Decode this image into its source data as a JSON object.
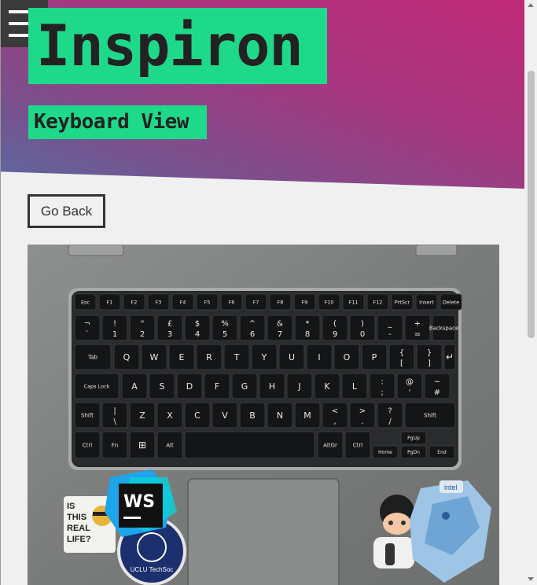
{
  "header": {
    "title": "Inspiron",
    "subtitle": "Keyboard View"
  },
  "menu": {
    "icon": "hamburger-menu-icon"
  },
  "actions": {
    "back_label": "Go Back"
  },
  "photo": {
    "subject": "laptop-keyboard-photo",
    "row_fn": [
      "Esc",
      "F1",
      "F2",
      "F3",
      "F4",
      "F5",
      "F6",
      "F7",
      "F8",
      "F9",
      "F10",
      "F11",
      "F12",
      "PrtScr",
      "Insert",
      "Delete"
    ],
    "row_num_top": [
      "¬",
      "!",
      "\"",
      "£",
      "$",
      "%",
      "^",
      "&",
      "*",
      "(",
      ")",
      "_",
      "+"
    ],
    "row_num_bottom": [
      "`",
      "1",
      "2",
      "3",
      "4",
      "5",
      "6",
      "7",
      "8",
      "9",
      "0",
      "-",
      "="
    ],
    "row_q": [
      "Q",
      "W",
      "E",
      "R",
      "T",
      "Y",
      "U",
      "I",
      "O",
      "P"
    ],
    "row_a": [
      "A",
      "S",
      "D",
      "F",
      "G",
      "H",
      "J",
      "K",
      "L"
    ],
    "row_z": [
      "Z",
      "X",
      "C",
      "V",
      "B",
      "N",
      "M"
    ],
    "mods": {
      "backspace": "Backspace",
      "tab": "Tab",
      "caps": "Caps Lock",
      "shift_l": "Shift",
      "shift_r": "Shift",
      "ctrl_l": "Ctrl",
      "fn": "Fn",
      "alt": "Alt",
      "altgr": "AltGr",
      "ctrl_r": "Ctrl",
      "home": "Home",
      "pgup": "PgUp",
      "pgdn": "PgDn",
      "end": "End",
      "euro": "€"
    },
    "stickers": {
      "ws": "WS",
      "isthis": "IS THIS REAL LIFE?",
      "uclu": "UCLU TechSoc",
      "intel": "intel"
    }
  },
  "colors": {
    "accent": "#1ed98a",
    "hero_start": "#c02a78",
    "hero_end": "#5a6aa0",
    "dark": "#3a3a3a"
  }
}
